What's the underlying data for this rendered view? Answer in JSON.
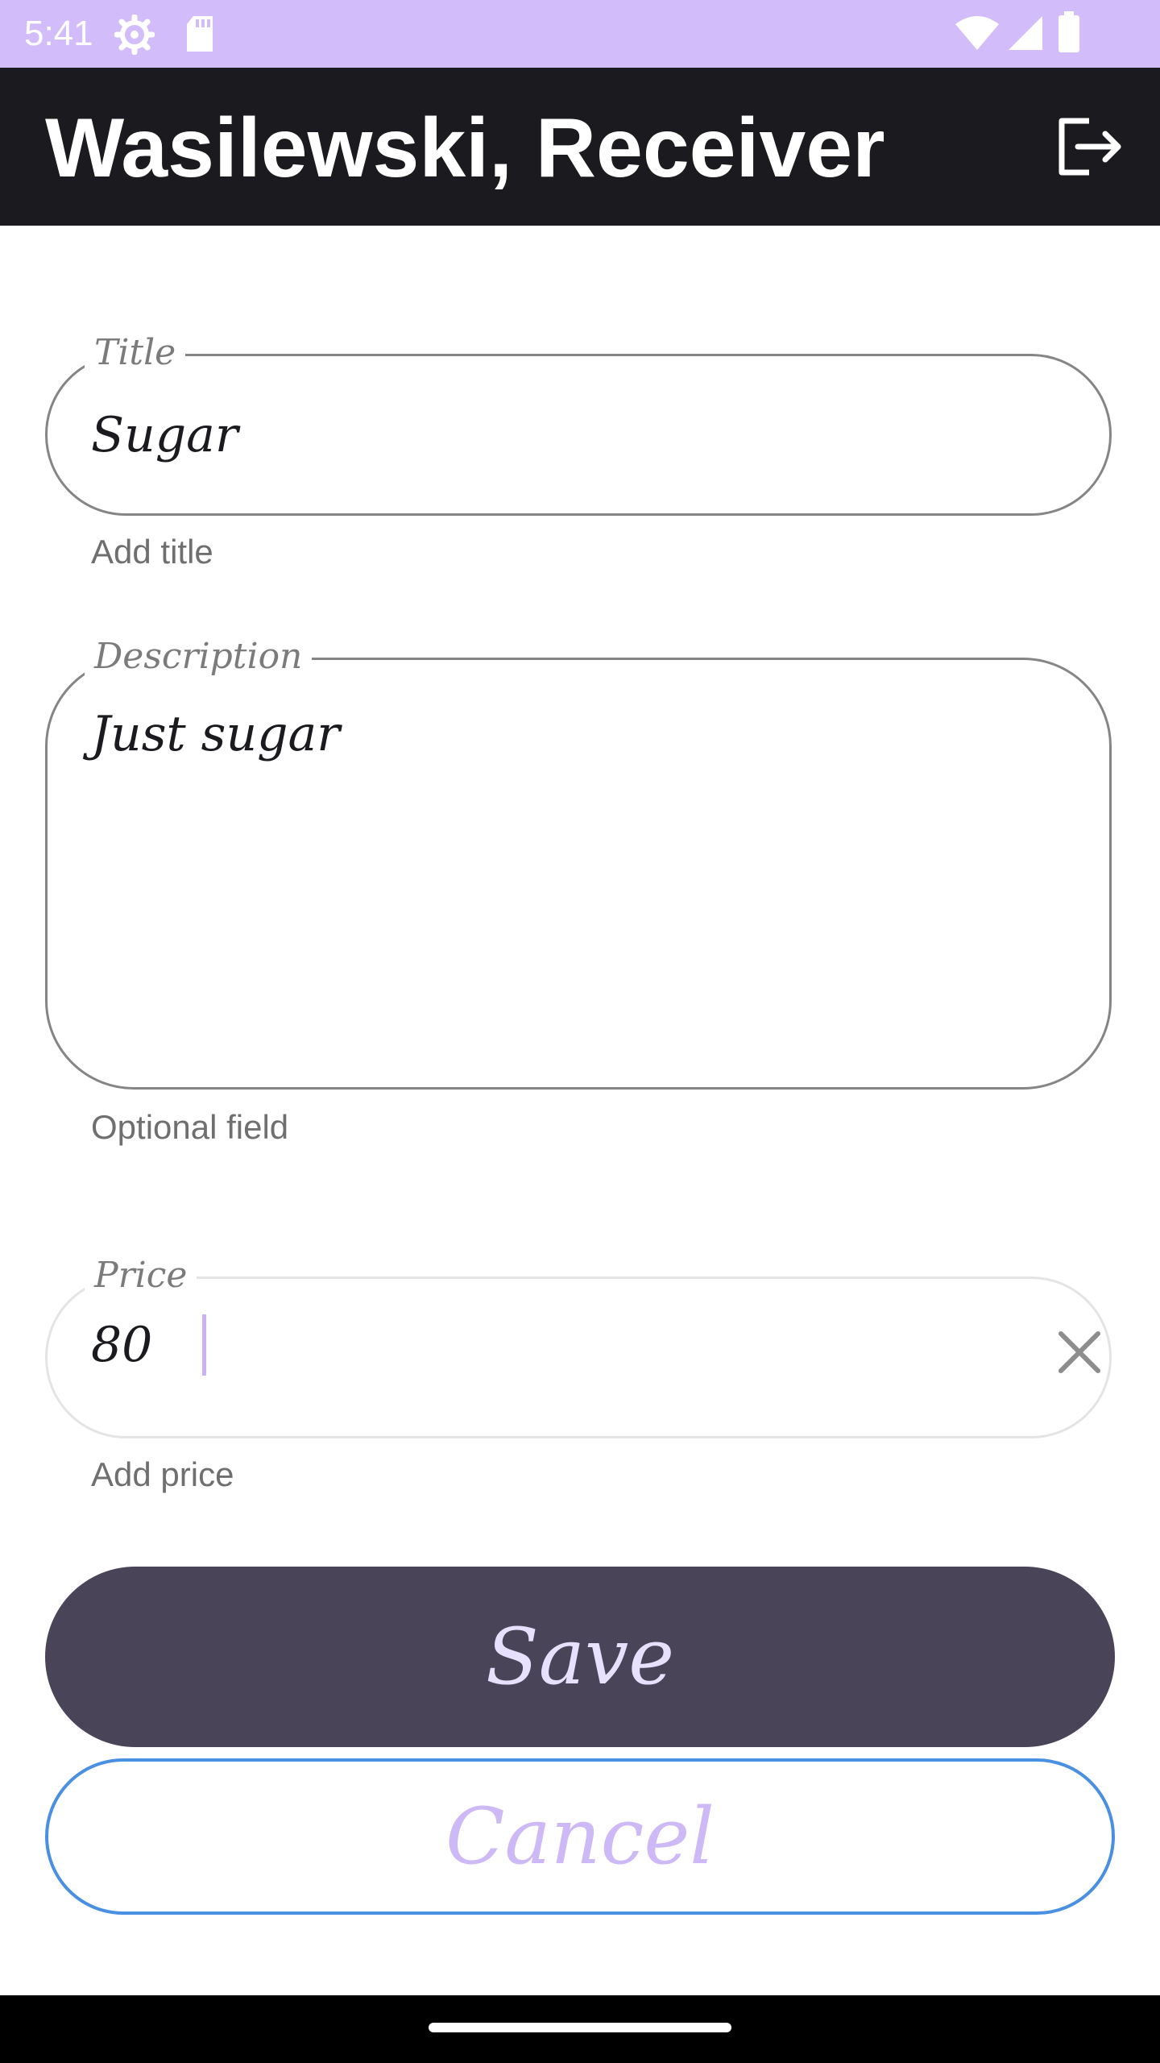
{
  "status_bar": {
    "time": "5:41",
    "icons": [
      "settings-icon",
      "sd-card-icon",
      "wifi-icon",
      "signal-icon",
      "battery-icon"
    ],
    "background": "#d2bdfa"
  },
  "app_bar": {
    "title": "Wasilewski, Receiver",
    "action_icon": "logout-icon",
    "background": "#1b1b1f"
  },
  "form": {
    "title": {
      "label": "Title",
      "value": "Sugar",
      "helper": "Add title"
    },
    "description": {
      "label": "Description",
      "value": "Just sugar",
      "helper": "Optional field"
    },
    "price": {
      "label": "Price",
      "value": "80",
      "helper": "Add price",
      "clear_icon": "close-icon"
    }
  },
  "actions": {
    "save_label": "Save",
    "cancel_label": "Cancel",
    "save_color": "#4a4458",
    "cancel_border_color": "#4a90e2",
    "accent_text_color": "#cdb9f6"
  }
}
